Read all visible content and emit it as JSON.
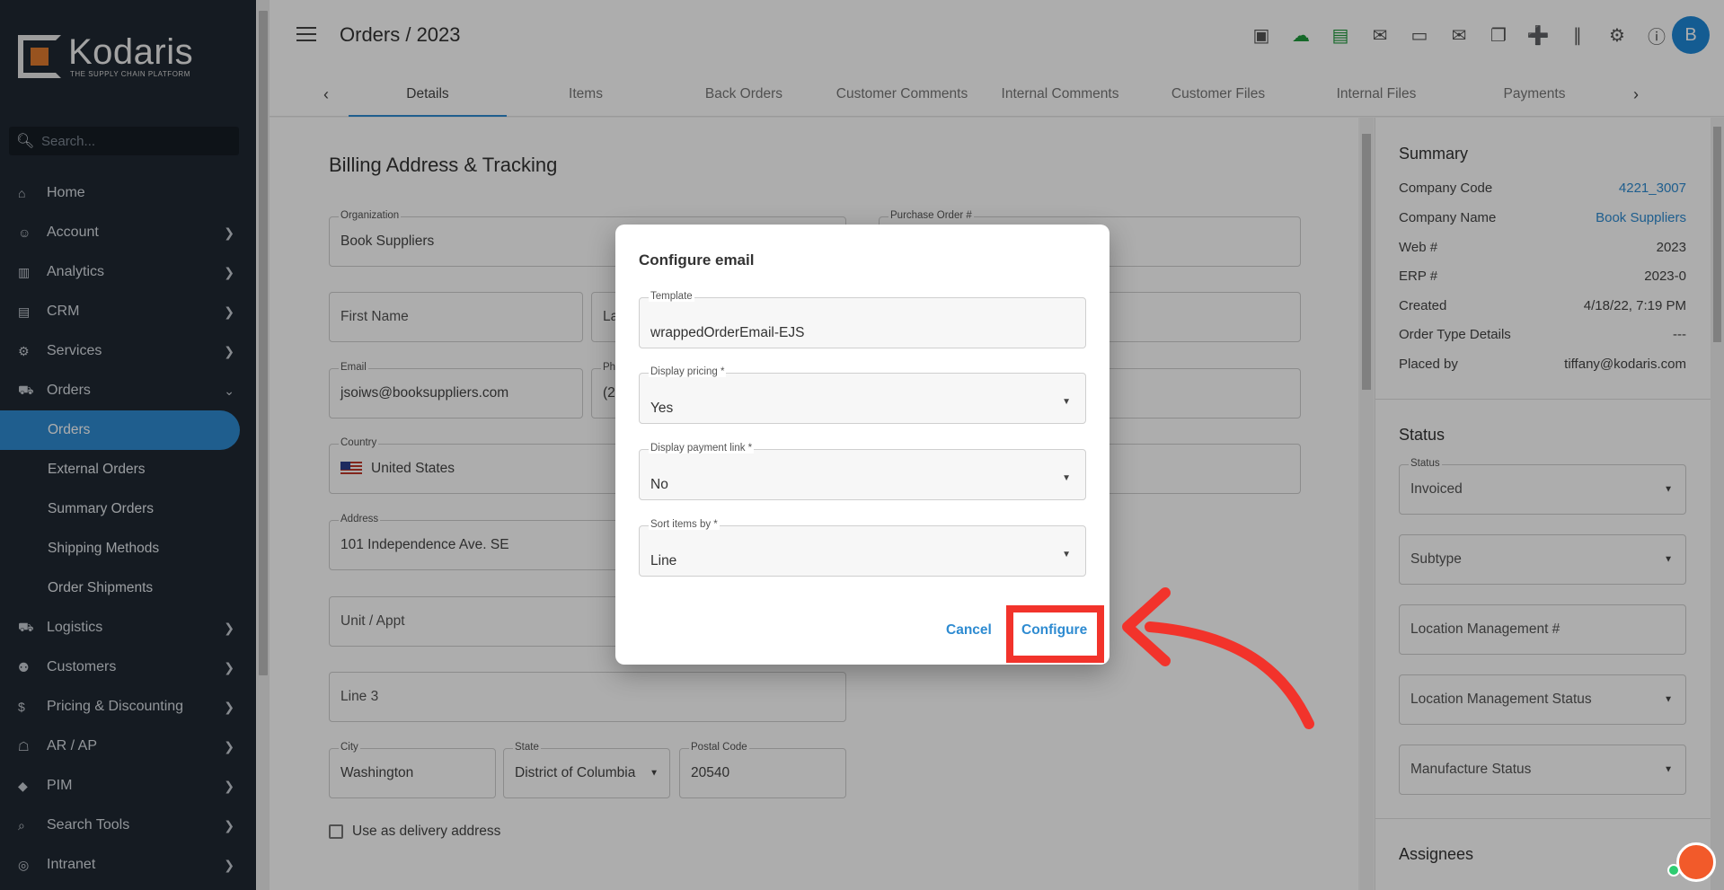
{
  "brand": {
    "name": "Kodaris",
    "tagline": "THE SUPPLY CHAIN PLATFORM"
  },
  "search": {
    "placeholder": "Search..."
  },
  "sidebar": {
    "items": [
      {
        "label": "Home"
      },
      {
        "label": "Account"
      },
      {
        "label": "Analytics"
      },
      {
        "label": "CRM"
      },
      {
        "label": "Services"
      },
      {
        "label": "Orders"
      }
    ],
    "orders_sub": [
      {
        "label": "Orders"
      },
      {
        "label": "External Orders"
      },
      {
        "label": "Summary Orders"
      },
      {
        "label": "Shipping Methods"
      },
      {
        "label": "Order Shipments"
      }
    ],
    "items_after": [
      {
        "label": "Logistics"
      },
      {
        "label": "Customers"
      },
      {
        "label": "Pricing & Discounting"
      },
      {
        "label": "AR / AP"
      },
      {
        "label": "PIM"
      },
      {
        "label": "Search Tools"
      },
      {
        "label": "Intranet"
      }
    ]
  },
  "header": {
    "title": "Orders / 2023",
    "avatar_initial": "B",
    "tabs": [
      "Details",
      "Items",
      "Back Orders",
      "Customer Comments",
      "Internal Comments",
      "Customer Files",
      "Internal Files",
      "Payments"
    ]
  },
  "billing": {
    "title": "Billing Address & Tracking",
    "organization_label": "Organization",
    "organization": "Book Suppliers",
    "po_label": "Purchase Order #",
    "first_name": "First Name",
    "last_name_partial": "La",
    "email_label": "Email",
    "email": "jsoiws@booksuppliers.com",
    "phone_label_partial": "Ph",
    "phone_partial": "(2",
    "country_label": "Country",
    "country": "United States",
    "address_label": "Address",
    "address": "101 Independence Ave. SE",
    "unit": "Unit / Appt",
    "line3": "Line 3",
    "city_label": "City",
    "city": "Washington",
    "state_label": "State",
    "state": "District of Columbia",
    "postal_label": "Postal Code",
    "postal": "20540",
    "delivery_checkbox": "Use as delivery address"
  },
  "summary": {
    "title": "Summary",
    "rows": [
      {
        "k": "Company Code",
        "v": "4221_3007"
      },
      {
        "k": "Company Name",
        "v": "Book Suppliers"
      },
      {
        "k": "Web #",
        "v": "2023"
      },
      {
        "k": "ERP #",
        "v": "2023-0"
      },
      {
        "k": "Created",
        "v": "4/18/22, 7:19 PM"
      },
      {
        "k": "Order Type Details",
        "v": "---"
      },
      {
        "k": "Placed by",
        "v": "tiffany@kodaris.com"
      }
    ]
  },
  "status": {
    "title": "Status",
    "status_label": "Status",
    "status_value": "Invoiced",
    "subtype": "Subtype",
    "location_mgmt_num": "Location Management #",
    "location_mgmt_status": "Location Management Status",
    "manufacture_status": "Manufacture Status"
  },
  "assignees": {
    "title": "Assignees"
  },
  "dialog": {
    "title": "Configure email",
    "template_label": "Template",
    "template_value": "wrappedOrderEmail-EJS",
    "pricing_label": "Display pricing *",
    "pricing_value": "Yes",
    "payment_label": "Display payment link *",
    "payment_value": "No",
    "sort_label": "Sort items by *",
    "sort_value": "Line",
    "cancel": "Cancel",
    "configure": "Configure"
  },
  "colors": {
    "accent": "#2e8bd1",
    "sidebar": "#1f2833",
    "annotation": "#f2332b"
  }
}
